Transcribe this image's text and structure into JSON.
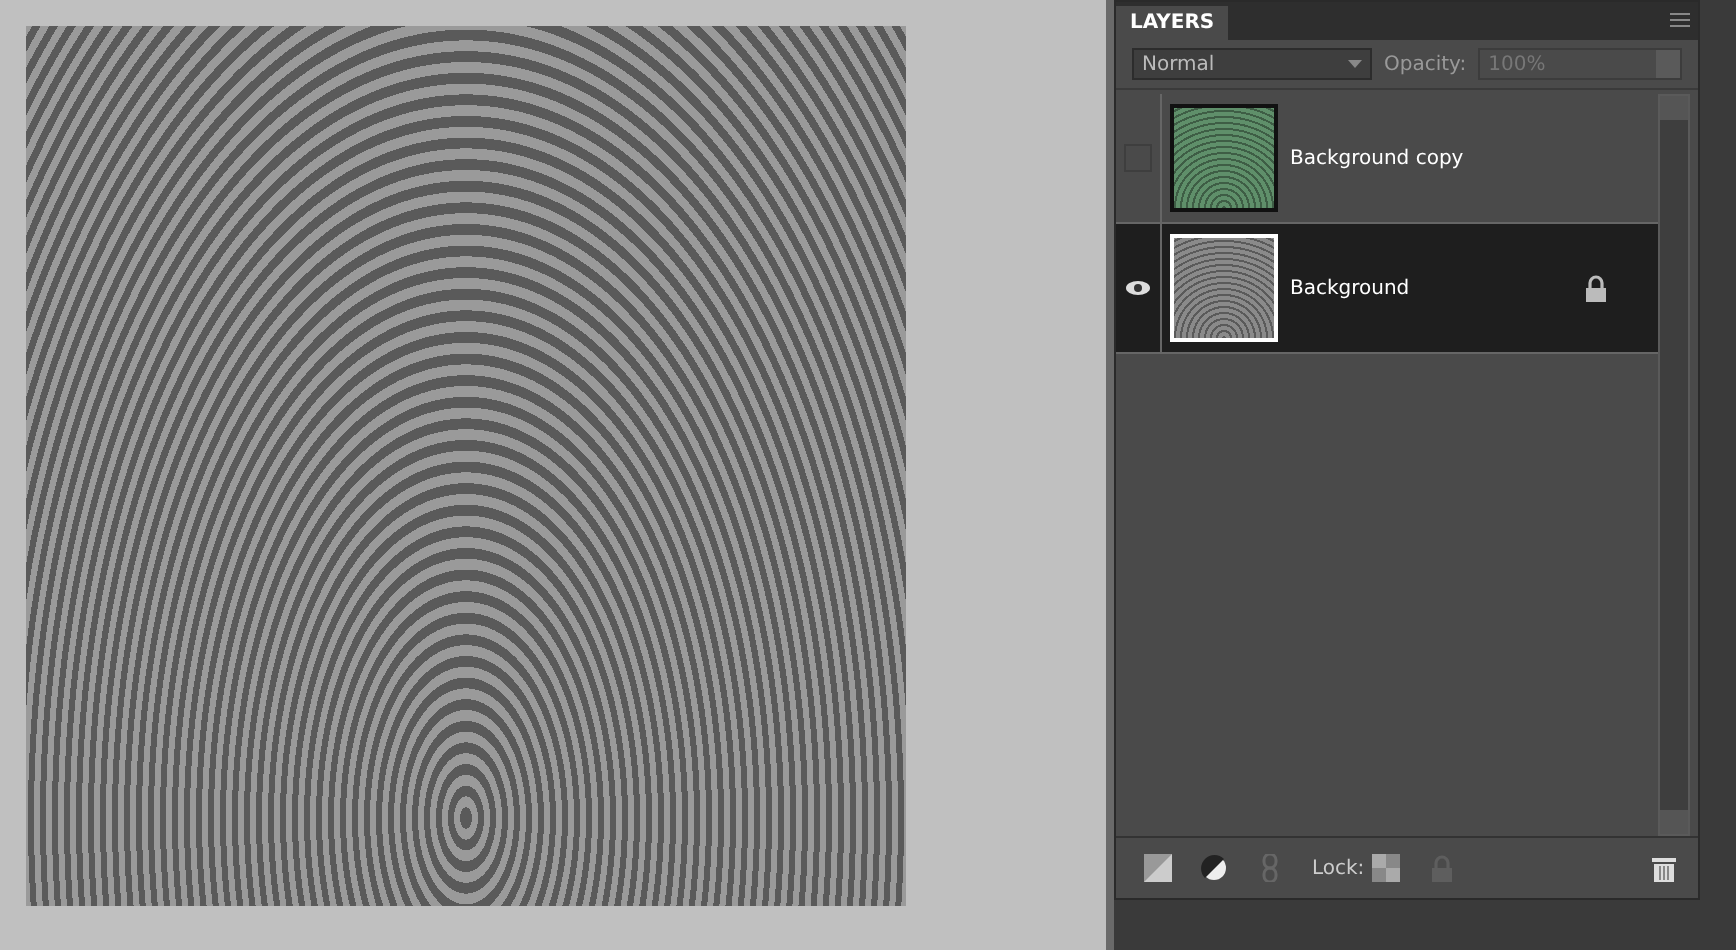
{
  "panel": {
    "title": "LAYERS"
  },
  "blend_mode": {
    "value": "Normal"
  },
  "opacity": {
    "label": "Opacity:",
    "value": "100%",
    "disabled": true
  },
  "layers": [
    {
      "name": "Background copy",
      "visible": false,
      "selected": false,
      "locked": false,
      "color": "#5f8f6a"
    },
    {
      "name": "Background",
      "visible": true,
      "selected": true,
      "locked": true,
      "color": "#8a8a8a"
    }
  ],
  "footer": {
    "lock_label": "Lock:"
  }
}
